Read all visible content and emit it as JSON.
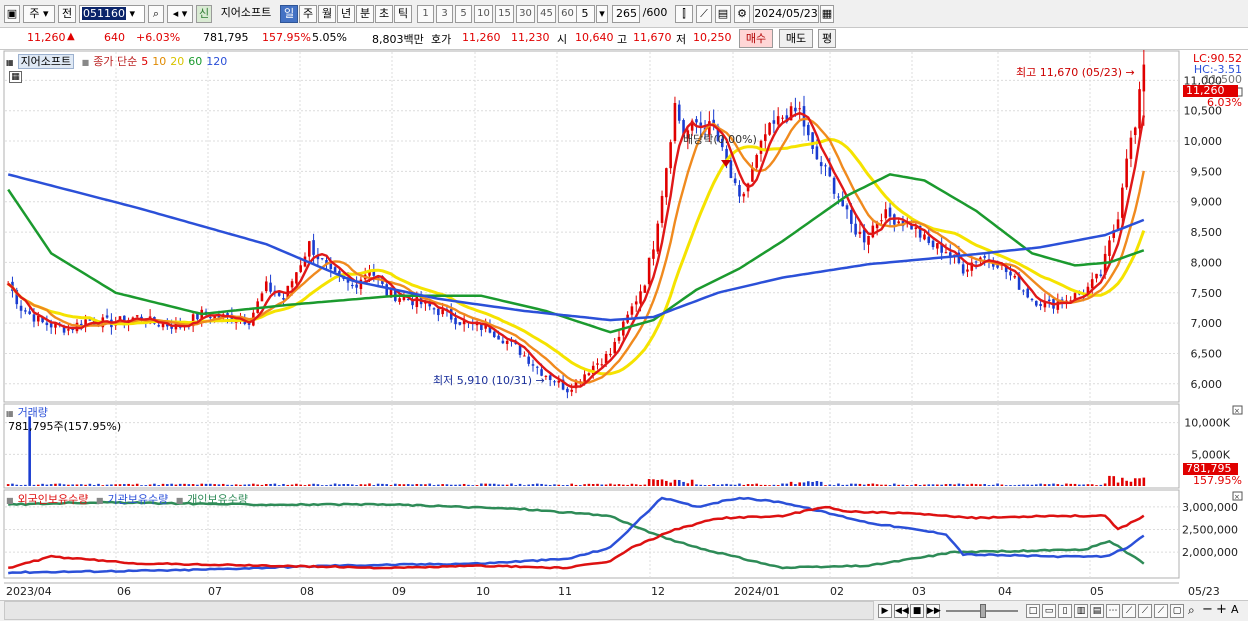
{
  "toolbar": {
    "market": "주",
    "mode": "전",
    "code": "051160",
    "new_badge": "신",
    "stock_name": "지어소프트",
    "periods": [
      "일",
      "주",
      "월",
      "년",
      "분",
      "초",
      "틱"
    ],
    "active_period": "일",
    "minutes": [
      "1",
      "3",
      "5",
      "10",
      "15",
      "30",
      "45",
      "60"
    ],
    "interval": "5",
    "count": "265",
    "count_max": "/600",
    "date": "2024/05/23"
  },
  "quote": {
    "price": "11,260",
    "change": "640",
    "change_pct": "+6.03%",
    "volume": "781,795",
    "volume_pct": "157.95%",
    "turnover": "5.05%",
    "amount": "8,803백만",
    "bid_label": "호가",
    "bid1": "11,260",
    "bid2": "11,230",
    "open_label": "시",
    "open": "10,640",
    "high_label": "고",
    "high": "11,670",
    "low_label": "저",
    "low": "10,250",
    "buy_label": "매수",
    "sell_label": "매도",
    "avg_label": "평"
  },
  "legend": {
    "name": "지어소프트",
    "ma_label": "종가 단순",
    "mas": [
      "5",
      "10",
      "20",
      "60",
      "120"
    ]
  },
  "price_tags": {
    "lc": "LC:90.52",
    "hc": "HC:-3.51",
    "top": "11,500",
    "current": "11,260",
    "pct": "6.03%"
  },
  "volume_panel": {
    "title": "거래량",
    "value": "781,795주(157.95%)",
    "tag": "781,795",
    "pct": "157.95%"
  },
  "holdings_panel": {
    "series": [
      "외국인보유수량",
      "기관보유수량",
      "개인보유수량"
    ]
  },
  "nav_date": "05/23",
  "colors": {
    "ma5": "#e01818",
    "ma10": "#f08a1e",
    "ma20": "#f5e300",
    "ma60": "#1b9a2e",
    "ma120": "#2b50d8",
    "up": "#e00000",
    "down": "#1a3cd0",
    "foreign": "#d11",
    "inst": "#2b50d8",
    "indiv": "#2e8b57"
  },
  "chart_data": {
    "type": "line",
    "price_axis": {
      "ticks": [
        6000,
        6500,
        7000,
        7500,
        8000,
        8500,
        9000,
        9500,
        10000,
        10500,
        11000
      ],
      "tick_labels": [
        "6,000",
        "6,500",
        "7,000",
        "7,500",
        "8,000",
        "8,500",
        "9,000",
        "9,500",
        "10,000",
        "10,500",
        "11,000"
      ]
    },
    "volume_axis": {
      "ticks": [
        5000000,
        10000000
      ],
      "tick_labels": [
        "5,000K",
        "10,000K"
      ]
    },
    "holdings_axis": {
      "ticks": [
        2000000,
        2500000,
        3000000
      ],
      "tick_labels": [
        "2,000,000",
        "2,500,000",
        "3,000,000"
      ]
    },
    "x_labels": [
      "2023/04",
      "06",
      "07",
      "08",
      "09",
      "10",
      "11",
      "12",
      "2024/01",
      "02",
      "03",
      "04",
      "05"
    ],
    "annotations": {
      "high": "최고 11,670 (05/23)",
      "low": "최저 5,910 (10/31)",
      "dividend": "배당락(0.00%)"
    },
    "close_guide": [
      [
        0,
        7650
      ],
      [
        3,
        7250
      ],
      [
        8,
        7000
      ],
      [
        14,
        6900
      ],
      [
        18,
        7050
      ],
      [
        24,
        7000
      ],
      [
        30,
        7100
      ],
      [
        34,
        7000
      ],
      [
        40,
        6950
      ],
      [
        45,
        7150
      ],
      [
        50,
        7100
      ],
      [
        56,
        7050
      ],
      [
        60,
        7600
      ],
      [
        64,
        7400
      ],
      [
        70,
        8300
      ],
      [
        75,
        7800
      ],
      [
        80,
        7600
      ],
      [
        84,
        7900
      ],
      [
        88,
        7500
      ],
      [
        95,
        7350
      ],
      [
        100,
        7200
      ],
      [
        106,
        7000
      ],
      [
        112,
        6900
      ],
      [
        118,
        6600
      ],
      [
        124,
        6200
      ],
      [
        130,
        5910
      ],
      [
        136,
        6300
      ],
      [
        140,
        6500
      ],
      [
        144,
        7100
      ],
      [
        148,
        7700
      ],
      [
        150,
        8300
      ],
      [
        153,
        9600
      ],
      [
        155,
        10600
      ],
      [
        157,
        10100
      ],
      [
        160,
        10300
      ],
      [
        164,
        10200
      ],
      [
        168,
        9400
      ],
      [
        170,
        9000
      ],
      [
        172,
        9300
      ],
      [
        176,
        10100
      ],
      [
        180,
        10400
      ],
      [
        184,
        10500
      ],
      [
        187,
        9800
      ],
      [
        190,
        9500
      ],
      [
        193,
        9100
      ],
      [
        196,
        8600
      ],
      [
        199,
        8400
      ],
      [
        203,
        8800
      ],
      [
        207,
        8700
      ],
      [
        210,
        8600
      ],
      [
        214,
        8300
      ],
      [
        218,
        8200
      ],
      [
        222,
        7900
      ],
      [
        226,
        8100
      ],
      [
        230,
        8000
      ],
      [
        234,
        7700
      ],
      [
        238,
        7400
      ],
      [
        242,
        7300
      ],
      [
        246,
        7400
      ],
      [
        250,
        7500
      ],
      [
        254,
        7800
      ],
      [
        258,
        8800
      ],
      [
        260,
        9800
      ],
      [
        262,
        10200
      ],
      [
        264,
        11260
      ]
    ],
    "ma120": [
      [
        0,
        9450
      ],
      [
        30,
        8900
      ],
      [
        60,
        8300
      ],
      [
        80,
        7700
      ],
      [
        100,
        7400
      ],
      [
        120,
        7200
      ],
      [
        140,
        7050
      ],
      [
        150,
        7100
      ],
      [
        165,
        7500
      ],
      [
        180,
        7750
      ],
      [
        200,
        7970
      ],
      [
        220,
        8100
      ],
      [
        240,
        8250
      ],
      [
        255,
        8450
      ],
      [
        264,
        8700
      ]
    ],
    "ma60": [
      [
        0,
        9200
      ],
      [
        10,
        8150
      ],
      [
        25,
        7500
      ],
      [
        45,
        7150
      ],
      [
        65,
        7300
      ],
      [
        90,
        7450
      ],
      [
        110,
        7450
      ],
      [
        125,
        7200
      ],
      [
        140,
        6850
      ],
      [
        150,
        7050
      ],
      [
        160,
        7550
      ],
      [
        170,
        7900
      ],
      [
        180,
        8350
      ],
      [
        195,
        9100
      ],
      [
        205,
        9450
      ],
      [
        213,
        9350
      ],
      [
        225,
        8850
      ],
      [
        238,
        8150
      ],
      [
        248,
        7950
      ],
      [
        256,
        8000
      ],
      [
        264,
        8200
      ]
    ],
    "volume": {
      "spike_index": 5,
      "spike_value": 11000000,
      "base": 200000
    },
    "holdings_guide": {
      "foreign": [
        [
          0,
          1650
        ],
        [
          10,
          1900
        ],
        [
          30,
          1750
        ],
        [
          60,
          1700
        ],
        [
          90,
          1650
        ],
        [
          110,
          1700
        ],
        [
          130,
          1650
        ],
        [
          140,
          1800
        ],
        [
          145,
          2100
        ],
        [
          155,
          2500
        ],
        [
          165,
          2750
        ],
        [
          180,
          2800
        ],
        [
          190,
          3000
        ],
        [
          195,
          2900
        ],
        [
          210,
          2850
        ],
        [
          225,
          2750
        ],
        [
          240,
          2800
        ],
        [
          255,
          2800
        ],
        [
          258,
          2500
        ],
        [
          264,
          2800
        ]
      ],
      "inst": [
        [
          0,
          1550
        ],
        [
          40,
          1600
        ],
        [
          75,
          1700
        ],
        [
          110,
          1750
        ],
        [
          130,
          1850
        ],
        [
          140,
          2100
        ],
        [
          152,
          3200
        ],
        [
          160,
          3000
        ],
        [
          170,
          3200
        ],
        [
          180,
          3100
        ],
        [
          200,
          2650
        ],
        [
          218,
          2400
        ],
        [
          222,
          1950
        ],
        [
          245,
          1900
        ],
        [
          255,
          1900
        ],
        [
          260,
          2100
        ],
        [
          264,
          2350
        ]
      ],
      "indiv": [
        [
          0,
          3050
        ],
        [
          20,
          3100
        ],
        [
          60,
          3050
        ],
        [
          90,
          3050
        ],
        [
          120,
          2950
        ],
        [
          140,
          2800
        ],
        [
          150,
          2400
        ],
        [
          160,
          2100
        ],
        [
          180,
          1650
        ],
        [
          200,
          1700
        ],
        [
          220,
          2000
        ],
        [
          250,
          2050
        ],
        [
          256,
          2250
        ],
        [
          264,
          1750
        ]
      ]
    }
  }
}
